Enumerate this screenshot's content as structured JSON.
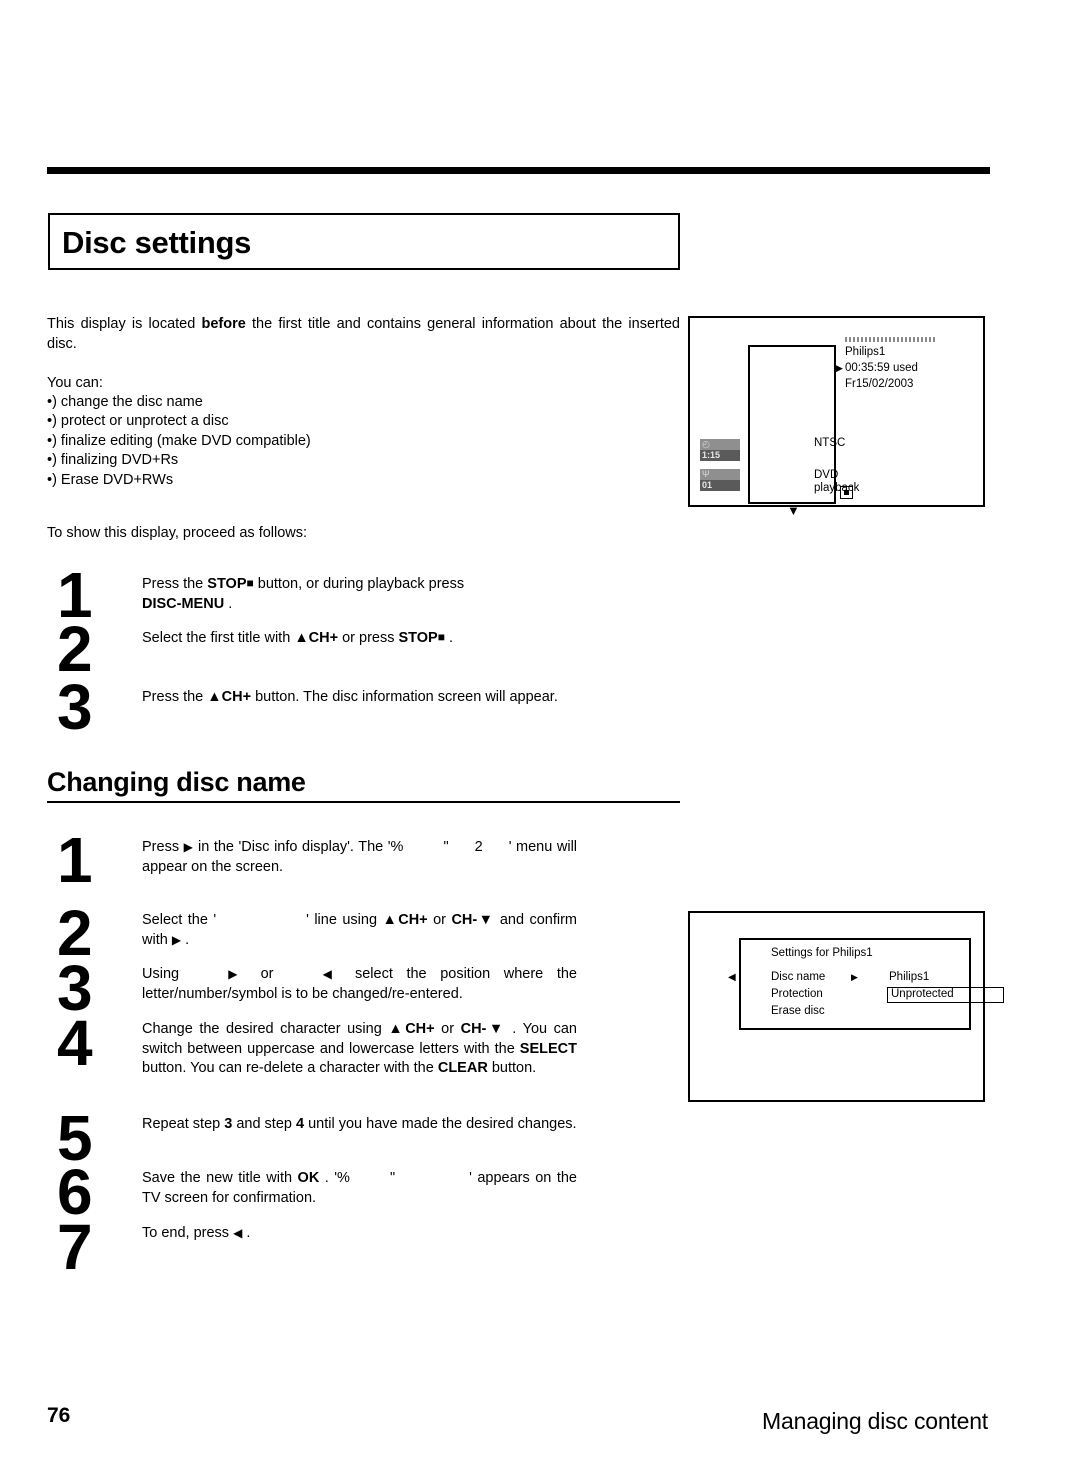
{
  "page": {
    "title": "Disc settings",
    "number": "76",
    "footer_right": "Managing disc content"
  },
  "intro": {
    "text_before": "This display is located ",
    "bold": "before",
    "text_after": " the first title and contains general information about the inserted disc.",
    "you_can_label": "You can:",
    "bullets": [
      "•) change the disc name",
      "•) protect or unprotect a disc",
      "•) finalize editing (make DVD compatible)",
      "•) finalizing DVD+Rs",
      "•) Erase DVD+RWs"
    ],
    "proceed": "To show this display, proceed as follows:"
  },
  "steps_disc_settings": [
    {
      "num": "1",
      "p1": "Press the ",
      "kw1": "STOP",
      "sq1": "■",
      "p2": " button, or during playback press",
      "kw2": "DISC-MENU",
      "p3": " ."
    },
    {
      "num": "2",
      "p1": "Select the first title with ",
      "kw1": "▲CH+",
      "p2": " or press ",
      "kw2": "STOP",
      "sq2": "■",
      "p3": " ."
    },
    {
      "num": "3",
      "p1": "Press the ",
      "kw1": "▲CH+",
      "p2": " button. The disc information screen will appear."
    }
  ],
  "section": {
    "heading": "Changing disc name"
  },
  "steps_changing_name": [
    {
      "num": "1",
      "p1": "Press ",
      "tri": "▶",
      "p2": " in the 'Disc info display'. The '%",
      "q": "\"",
      "two": "2",
      "p3": "' menu will appear on the screen."
    },
    {
      "num": "2",
      "p1": "Select the '",
      "p2": "' line using ",
      "kw1": "▲CH+",
      "p3": " or ",
      "kw2": "CH-▼",
      "p4": " and confirm with ",
      "tri": "▶",
      "p5": " ."
    },
    {
      "num": "3",
      "p1": "Using ",
      "tri1": "▶",
      "p2": " or ",
      "tri2": "◀",
      "p3": " select the position where the letter/number/symbol is to be changed/re-entered."
    },
    {
      "num": "4",
      "p1": "Change the desired character using ",
      "kw1": "▲CH+",
      "p2": " or ",
      "kw2": "CH-▼",
      "p3": " . You can switch between uppercase and lowercase letters with the ",
      "kw3": "SELECT",
      "p4": " button. You can re-delete a character with the ",
      "kw4": "CLEAR",
      "p5": " button."
    },
    {
      "num": "5",
      "p1": "Repeat step ",
      "b1": "3",
      "p2": " and step ",
      "b2": "4",
      "p3": " until you have made the desired changes."
    },
    {
      "num": "6",
      "p1": "Save the new title with ",
      "kw1": "OK",
      "p2": " . '%",
      "q": "\"",
      "p3": "' appears on the TV screen for confirmation."
    },
    {
      "num": "7",
      "p1": "To end, press ",
      "tri": "◀",
      "p2": " ."
    }
  ],
  "diagram_disc_info": {
    "panel": {
      "standard": "NTSC",
      "mode": "DVD playback"
    },
    "info": {
      "disc_name": "Philips1",
      "time_used": "00:35:59 used",
      "date": "Fr15/02/2003",
      "marker": "▶"
    },
    "caret": "▼",
    "side_icons": [
      {
        "symbol": "◴",
        "value": "1:15"
      },
      {
        "symbol": "Ψ",
        "value": "01"
      }
    ]
  },
  "diagram_settings": {
    "title": "Settings for Philips1",
    "rows": [
      "Disc name",
      "Protection",
      "Erase disc"
    ],
    "cursor": "◀",
    "arrow": "▶",
    "value_disc_name": "Philips1",
    "value_protection": "Unprotected"
  }
}
